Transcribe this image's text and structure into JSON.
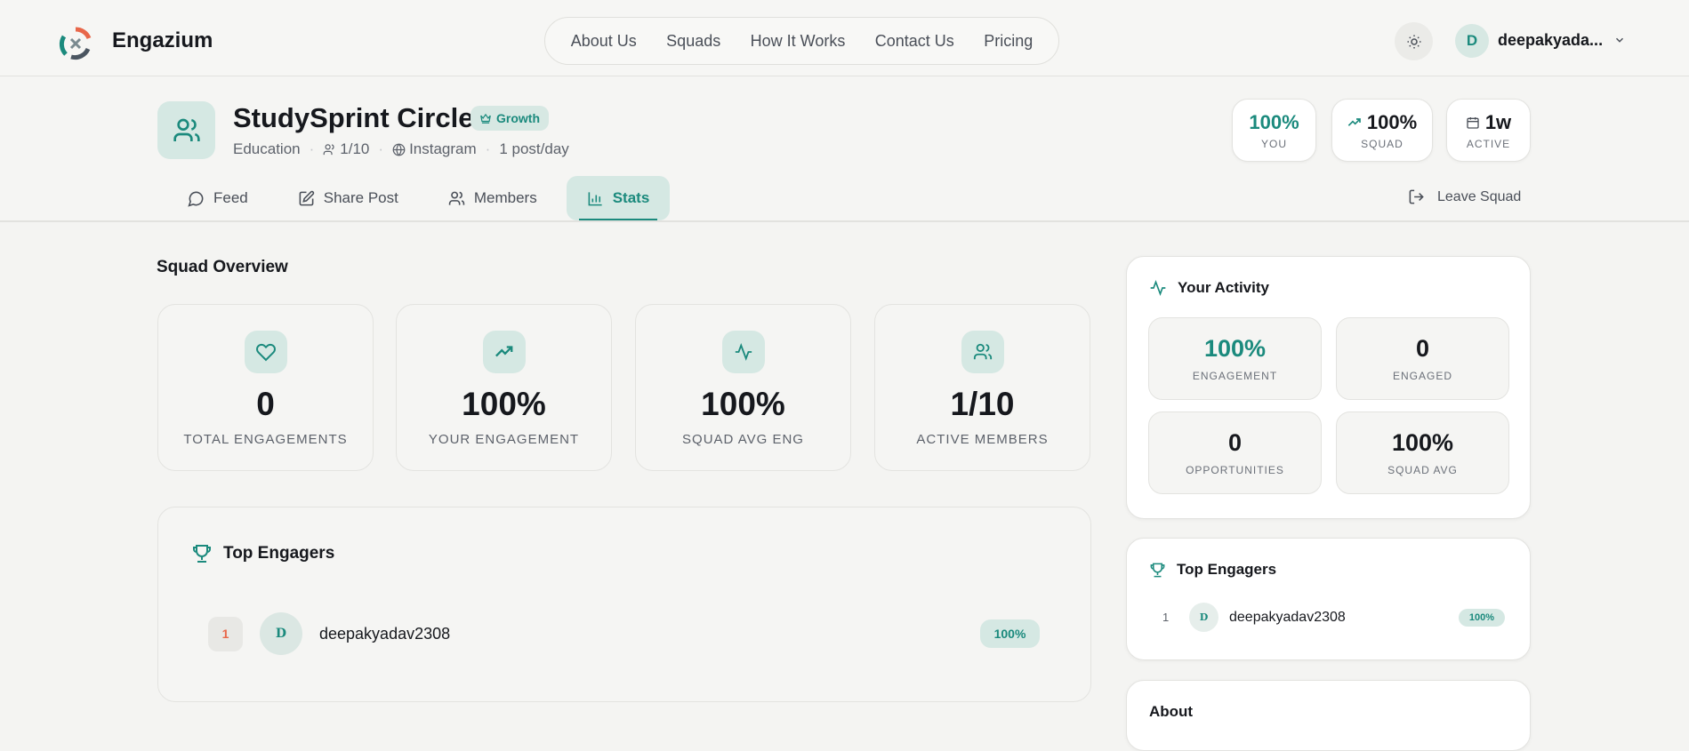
{
  "header": {
    "brand": "Engazium",
    "nav": [
      "About Us",
      "Squads",
      "How It Works",
      "Contact Us",
      "Pricing"
    ],
    "user_initial": "D",
    "username": "deepakyada..."
  },
  "squad": {
    "name": "StudySprint Circle",
    "tier": "Growth",
    "category": "Education",
    "members": "1/10",
    "platform": "Instagram",
    "frequency": "1 post/day",
    "mini_stats": [
      {
        "value": "100%",
        "label": "YOU"
      },
      {
        "value": "100%",
        "label": "SQUAD"
      },
      {
        "value": "1w",
        "label": "ACTIVE"
      }
    ],
    "tabs": [
      "Feed",
      "Share Post",
      "Members",
      "Stats"
    ],
    "leave": "Leave Squad"
  },
  "overview": {
    "title": "Squad Overview",
    "stats": [
      {
        "value": "0",
        "label": "TOTAL ENGAGEMENTS"
      },
      {
        "value": "100%",
        "label": "YOUR ENGAGEMENT"
      },
      {
        "value": "100%",
        "label": "SQUAD AVG ENG"
      },
      {
        "value": "1/10",
        "label": "ACTIVE MEMBERS"
      }
    ]
  },
  "top_engagers": {
    "title": "Top Engagers",
    "entries": [
      {
        "rank": "1",
        "initial": "D",
        "name": "deepakyadav2308",
        "score": "100%"
      }
    ]
  },
  "activity": {
    "title": "Your Activity",
    "tiles": [
      {
        "value": "100%",
        "label": "ENGAGEMENT"
      },
      {
        "value": "0",
        "label": "ENGAGED"
      },
      {
        "value": "0",
        "label": "OPPORTUNITIES"
      },
      {
        "value": "100%",
        "label": "SQUAD AVG"
      }
    ]
  },
  "about": {
    "title": "About"
  },
  "colors": {
    "accent": "#1b8a7d",
    "accent_bg": "#d5e8e3",
    "rank": "#e8674a"
  }
}
